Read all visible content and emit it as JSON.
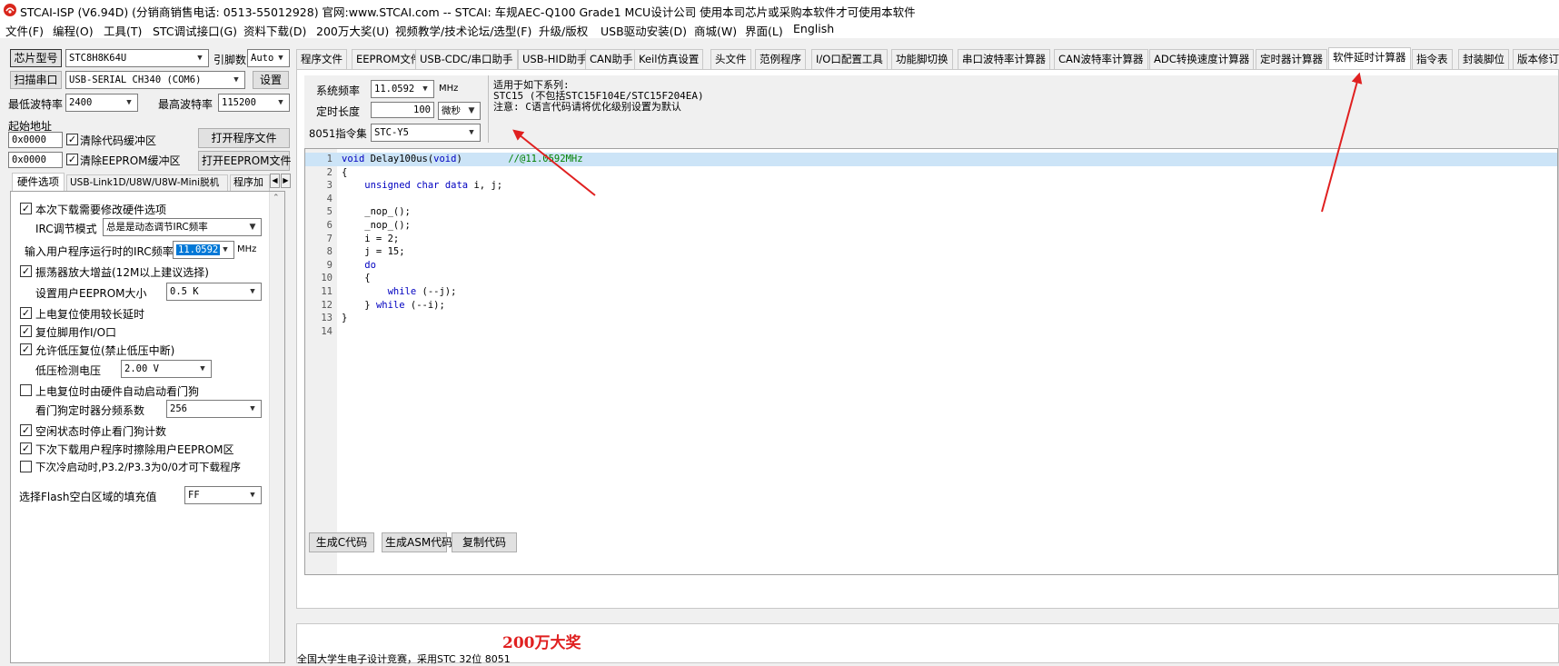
{
  "window": {
    "title": "STCAI-ISP (V6.94D) (分销商销售电话: 0513-55012928) 官网:www.STCAI.com  -- STCAI: 车规AEC-Q100 Grade1 MCU设计公司 使用本司芯片或采购本软件才可使用本软件"
  },
  "menu": [
    "文件(F)",
    "编程(O)",
    "工具(T)",
    "STC调试接口(G)",
    "资料下载(D)",
    "200万大奖(U)",
    "视频教学/技术论坛/选型(F)",
    "升级/版权",
    "USB驱动安装(D)",
    "商城(W)",
    "界面(L)",
    "English"
  ],
  "left": {
    "chip_label": "芯片型号",
    "chip_value": "STC8H8K64U",
    "pins_label": "引脚数",
    "pins_value": "Auto",
    "scan_label": "扫描串口",
    "port_value": "USB-SERIAL CH340 (COM6)",
    "settings_label": "设置",
    "min_baud_label": "最低波特率",
    "min_baud_value": "2400",
    "max_baud_label": "最高波特率",
    "max_baud_value": "115200",
    "start_addr_label": "起始地址",
    "addr1": "0x0000",
    "clear_code_label": "清除代码缓冲区",
    "open_prog_label": "打开程序文件",
    "addr2": "0x0000",
    "clear_eeprom_label": "清除EEPROM缓冲区",
    "open_eeprom_label": "打开EEPROM文件",
    "subtabs": [
      "硬件选项",
      "USB-Link1D/U8W/U8W-Mini脱机",
      "程序加"
    ],
    "options": {
      "opt_modify_hw": "本次下载需要修改硬件选项",
      "irc_mode_label": "IRC调节模式",
      "irc_mode_value": "总是是动态调节IRC频率",
      "irc_freq_label": "输入用户程序运行时的IRC频率",
      "irc_freq_value": "11.0592",
      "irc_freq_unit": "MHz",
      "opt_osc_gain": "振荡器放大增益(12M以上建议选择)",
      "eeprom_size_label": "设置用户EEPROM大小",
      "eeprom_size_value": "0.5 K",
      "opt_power_delay": "上电复位使用较长延时",
      "opt_reset_io": "复位脚用作I/O口",
      "opt_low_volt_reset": "允许低压复位(禁止低压中断)",
      "low_volt_label": "低压检测电压",
      "low_volt_value": "2.00 V",
      "opt_watchdog": "上电复位时由硬件自动启动看门狗",
      "wdt_div_label": "看门狗定时器分频系数",
      "wdt_div_value": "256",
      "opt_idle_stop_wdt": "空闲状态时停止看门狗计数",
      "opt_erase_eeprom": "下次下载用户程序时擦除用户EEPROM区",
      "opt_cold_boot": "下次冷启动时,P3.2/P3.3为0/0才可下载程序",
      "flash_fill_label": "选择Flash空白区域的填充值",
      "flash_fill_value": "FF"
    }
  },
  "tabs": [
    "程序文件",
    "EEPROM文件",
    "USB-CDC/串口助手",
    "USB-HID助手",
    "CAN助手",
    "Keil仿真设置",
    "头文件",
    "范例程序",
    "I/O口配置工具",
    "功能脚切换",
    "串口波特率计算器",
    "CAN波特率计算器",
    "ADC转换速度计算器",
    "定时器计算器",
    "软件延时计算器",
    "指令表",
    "封装脚位",
    "版本修订"
  ],
  "delay": {
    "sysfreq_label": "系统频率",
    "sysfreq_value": "11.0592",
    "sysfreq_unit": "MHz",
    "duration_label": "定时长度",
    "duration_value": "100",
    "duration_unit": "微秒",
    "isa_label": "8051指令集",
    "isa_value": "STC-Y5",
    "note1": "适用于如下系列:",
    "note2": "STC15 (不包括STC15F104E/STC15F204EA)",
    "note3": "注意: C语言代码请将优化级别设置为默认",
    "gen_c_label": "生成C代码",
    "gen_asm_label": "生成ASM代码",
    "copy_label": "复制代码"
  },
  "code_lines": [
    {
      "n": "1",
      "t": "void Delay100us(void)\t\t//@11.0592MHz"
    },
    {
      "n": "2",
      "t": "{"
    },
    {
      "n": "3",
      "t": "\tunsigned char data i, j;"
    },
    {
      "n": "4",
      "t": ""
    },
    {
      "n": "5",
      "t": "\t_nop_();"
    },
    {
      "n": "6",
      "t": "\t_nop_();"
    },
    {
      "n": "7",
      "t": "\ti = 2;"
    },
    {
      "n": "8",
      "t": "\tj = 15;"
    },
    {
      "n": "9",
      "t": "\tdo"
    },
    {
      "n": "10",
      "t": "\t{"
    },
    {
      "n": "11",
      "t": "\t\twhile (--j);"
    },
    {
      "n": "12",
      "t": "\t} while (--i);"
    },
    {
      "n": "13",
      "t": "}"
    },
    {
      "n": "14",
      "t": ""
    }
  ],
  "bottom": {
    "prize_title": "200万大奖",
    "prize_text": "全国大学生电子设计竞赛，采用STC 32位 8051"
  },
  "colors": {
    "accent_red": "#e02020",
    "highlight_line": "#cce4f7",
    "keyword": "#0000c0",
    "comment": "#008000"
  }
}
